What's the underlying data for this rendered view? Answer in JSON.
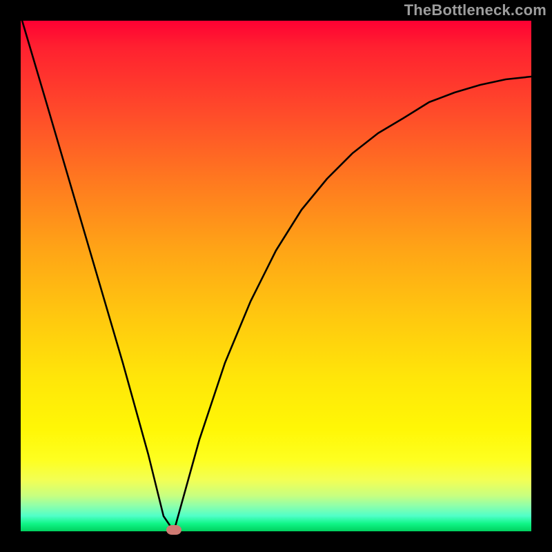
{
  "watermark": "TheBottleneck.com",
  "chart_data": {
    "type": "line",
    "title": "",
    "xlabel": "",
    "ylabel": "",
    "xlim": [
      0,
      100
    ],
    "ylim": [
      0,
      100
    ],
    "series": [
      {
        "name": "curve",
        "x": [
          0,
          5,
          10,
          15,
          20,
          25,
          28,
          30,
          35,
          40,
          45,
          50,
          55,
          60,
          65,
          70,
          75,
          80,
          85,
          90,
          95,
          100
        ],
        "y": [
          101,
          84,
          67,
          50,
          33,
          15,
          3,
          0,
          18,
          33,
          45,
          55,
          63,
          69,
          74,
          78,
          81,
          84,
          86,
          87.5,
          88.5,
          89
        ]
      }
    ],
    "marker": {
      "x": 30,
      "y": 0,
      "color": "#cf7a72"
    },
    "background_gradient": {
      "top": "#ff0033",
      "bottom": "#00d05e"
    }
  }
}
